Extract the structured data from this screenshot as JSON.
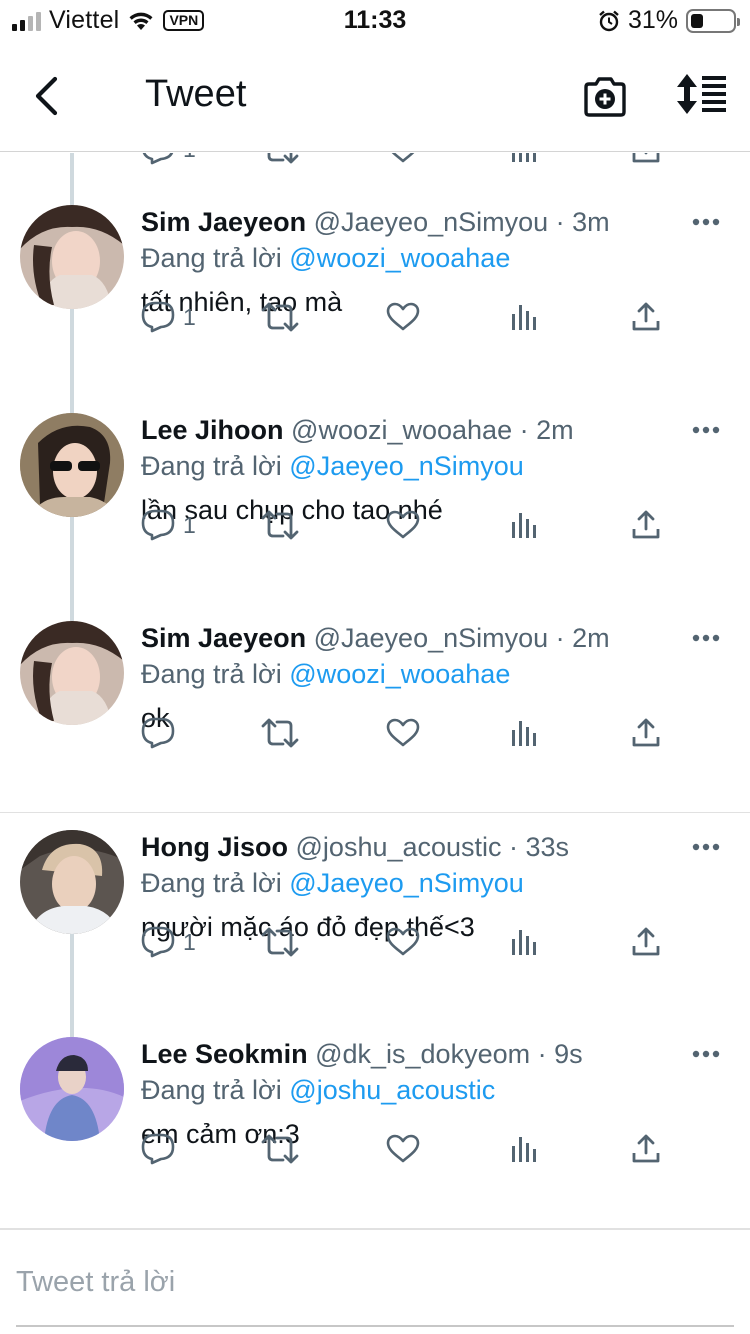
{
  "status_bar": {
    "carrier": "Viettel",
    "vpn": "VPN",
    "time": "11:33",
    "battery": "31%",
    "battery_level": 0.31
  },
  "header": {
    "title": "Tweet"
  },
  "partial_tweet": {
    "reply_count": "1"
  },
  "tweets": [
    {
      "name": "Sim Jaeyeon",
      "handle": "@Jaeyeo_nSimyou · 3m",
      "replying_label": "Đang trả lời",
      "replying_to": "@woozi_wooahae",
      "text": "tất nhiên, tao mà",
      "reply_count": "1"
    },
    {
      "name": "Lee Jihoon",
      "handle": "@woozi_wooahae · 2m",
      "replying_label": "Đang trả lời",
      "replying_to": "@Jaeyeo_nSimyou",
      "text": "lần sau chụp cho tao nhé",
      "reply_count": "1"
    },
    {
      "name": "Sim Jaeyeon",
      "handle": "@Jaeyeo_nSimyou · 2m",
      "replying_label": "Đang trả lời",
      "replying_to": "@woozi_wooahae",
      "text": "ok",
      "reply_count": ""
    },
    {
      "name": "Hong Jisoo",
      "handle": "@joshu_acoustic · 33s",
      "replying_label": "Đang trả lời",
      "replying_to": "@Jaeyeo_nSimyou",
      "text": "người mặc áo đỏ đẹp thế<3",
      "reply_count": "1"
    },
    {
      "name": "Lee Seokmin",
      "handle": "@dk_is_dokyeom · 9s",
      "replying_label": "Đang trả lời",
      "replying_to": "@joshu_acoustic",
      "text": "em cảm ơn:3",
      "reply_count": ""
    }
  ],
  "reply_box": {
    "placeholder": "Tweet trả lời"
  },
  "colors": {
    "accent": "#1d9bf0",
    "secondary_text": "#536471",
    "thread_line": "#cfd9de"
  }
}
